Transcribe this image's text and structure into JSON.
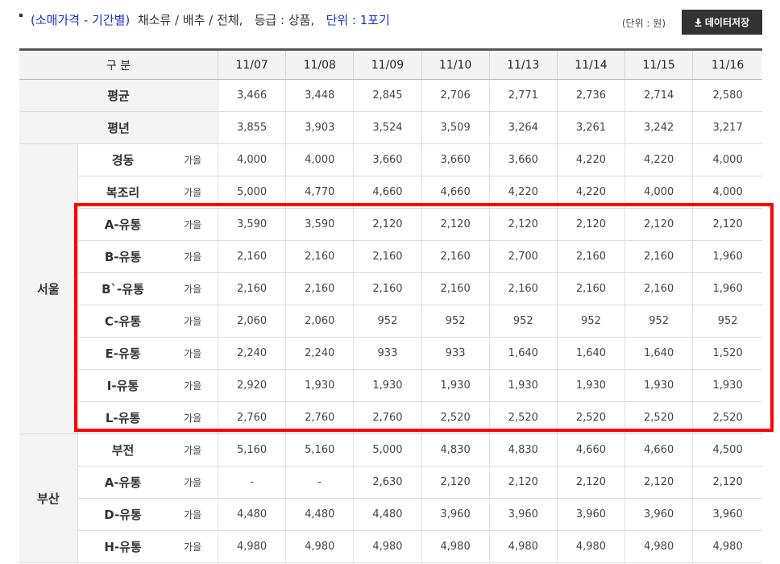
{
  "header": {
    "category": "(소매가격 - 기간별)",
    "item": "채소류 / 배추 / 전체,",
    "grade": "등급 : 상품,",
    "unit": "단위 : 1포기",
    "unit_note": "(단위 : 원)",
    "download_label": "데이터저장"
  },
  "table": {
    "header_label": "구 분",
    "dates": [
      "11/07",
      "11/08",
      "11/09",
      "11/10",
      "11/13",
      "11/14",
      "11/15",
      "11/16"
    ],
    "summary_rows": [
      {
        "label": "평균",
        "values": [
          "3,466",
          "3,448",
          "2,845",
          "2,706",
          "2,771",
          "2,736",
          "2,714",
          "2,580"
        ]
      },
      {
        "label": "평년",
        "values": [
          "3,855",
          "3,903",
          "3,524",
          "3,509",
          "3,264",
          "3,261",
          "3,242",
          "3,217"
        ]
      }
    ],
    "groups": [
      {
        "city": "서울",
        "rows": [
          {
            "market": "경동",
            "grade": "가을",
            "values": [
              "4,000",
              "4,000",
              "3,660",
              "3,660",
              "3,660",
              "4,220",
              "4,220",
              "4,000"
            ]
          },
          {
            "market": "복조리",
            "grade": "가을",
            "values": [
              "5,000",
              "4,770",
              "4,660",
              "4,660",
              "4,220",
              "4,220",
              "4,000",
              "4,000"
            ]
          },
          {
            "market": "A-유통",
            "grade": "가을",
            "values": [
              "3,590",
              "3,590",
              "2,120",
              "2,120",
              "2,120",
              "2,120",
              "2,120",
              "2,120"
            ]
          },
          {
            "market": "B-유통",
            "grade": "가을",
            "values": [
              "2,160",
              "2,160",
              "2,160",
              "2,160",
              "2,700",
              "2,160",
              "2,160",
              "1,960"
            ]
          },
          {
            "market": "B`-유통",
            "grade": "가을",
            "values": [
              "2,160",
              "2,160",
              "2,160",
              "2,160",
              "2,160",
              "2,160",
              "2,160",
              "1,960"
            ]
          },
          {
            "market": "C-유통",
            "grade": "가을",
            "values": [
              "2,060",
              "2,060",
              "952",
              "952",
              "952",
              "952",
              "952",
              "952"
            ]
          },
          {
            "market": "E-유통",
            "grade": "가을",
            "values": [
              "2,240",
              "2,240",
              "933",
              "933",
              "1,640",
              "1,640",
              "1,640",
              "1,520"
            ]
          },
          {
            "market": "I-유통",
            "grade": "가을",
            "values": [
              "2,920",
              "1,930",
              "1,930",
              "1,930",
              "1,930",
              "1,930",
              "1,930",
              "1,930"
            ]
          },
          {
            "market": "L-유통",
            "grade": "가을",
            "values": [
              "2,760",
              "2,760",
              "2,760",
              "2,520",
              "2,520",
              "2,520",
              "2,520",
              "2,520"
            ]
          }
        ]
      },
      {
        "city": "부산",
        "rows": [
          {
            "market": "부전",
            "grade": "가을",
            "values": [
              "5,160",
              "5,160",
              "5,000",
              "4,830",
              "4,830",
              "4,660",
              "4,660",
              "4,500"
            ]
          },
          {
            "market": "A-유통",
            "grade": "가을",
            "values": [
              "-",
              "-",
              "2,630",
              "2,120",
              "2,120",
              "2,120",
              "2,120",
              "2,120"
            ]
          },
          {
            "market": "D-유통",
            "grade": "가을",
            "values": [
              "4,480",
              "4,480",
              "4,480",
              "3,960",
              "3,960",
              "3,960",
              "3,960",
              "3,960"
            ]
          },
          {
            "market": "H-유통",
            "grade": "가을",
            "values": [
              "4,980",
              "4,980",
              "4,980",
              "4,980",
              "4,980",
              "4,980",
              "4,980",
              "4,980"
            ]
          }
        ]
      }
    ]
  },
  "colors": {
    "highlight": "#ff0000",
    "accent_blue": "#1a32c8",
    "button_bg": "#333333"
  },
  "icons": {
    "download": "download-icon"
  }
}
